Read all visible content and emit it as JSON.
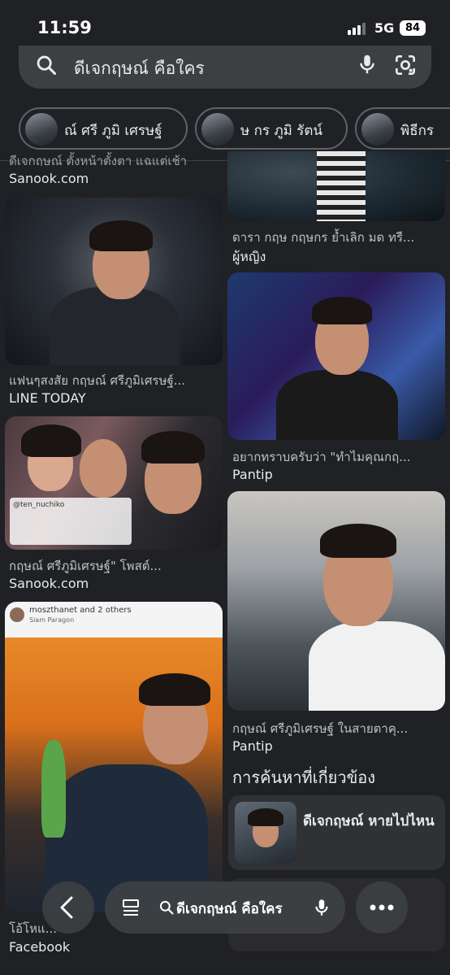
{
  "status_bar": {
    "time": "11:59",
    "network": "5G",
    "battery": "84"
  },
  "search": {
    "query": "ดีเจกฤษณ์ คือใคร",
    "icon": "search-icon",
    "mic_icon": "mic-icon",
    "lens_icon": "lens-icon"
  },
  "chips": [
    {
      "label": "ณ์ ศรี ภูมิ เศรษฐ์"
    },
    {
      "label": "ษ กร ภูมิ รัตน์"
    },
    {
      "label": "พิธีกร"
    }
  ],
  "results": {
    "left_top_caption": "ดีเจกฤษณ์ ตั้งหน้าตั้งตา แฉแต่เช้า",
    "left_top_source": "Sanook.com",
    "right_top_caption": "ดารา กฤษ กฤษกร ย้ำเลิก มด ทรี...",
    "right_top_source": "ผู้หญิง",
    "item1_caption": "แฟนๆสงสัย กฤษณ์ ศรีภูมิเศรษฐ์...",
    "item1_source": "LINE TODAY",
    "item2_caption": "อยากทราบครับว่า \"ทำไมคุณกฤ...",
    "item2_source": "Pantip",
    "item3_caption": "กฤษณ์ ศรีภูมิเศรษฐ์\" โพสต์...",
    "item3_source": "Sanook.com",
    "item3_overlay_handle": "@ten_nuchiko",
    "item4_caption": "กฤษณ์ ศรีภูมิเศรษฐ์ ในสายตาคุ...",
    "item4_source": "Pantip",
    "item5_user": "moszthanet and 2 others",
    "item5_place": "Siam Paragon",
    "item5_caption": "โอ้โหแ...",
    "item5_source": "Facebook"
  },
  "related": {
    "title": "การค้นหาที่เกี่ยวข้อง",
    "card_label": "ดีเจกฤษณ์ หายไปไหน"
  },
  "bottom_bar": {
    "query": "ดีเจกฤษณ์ คือใคร"
  }
}
